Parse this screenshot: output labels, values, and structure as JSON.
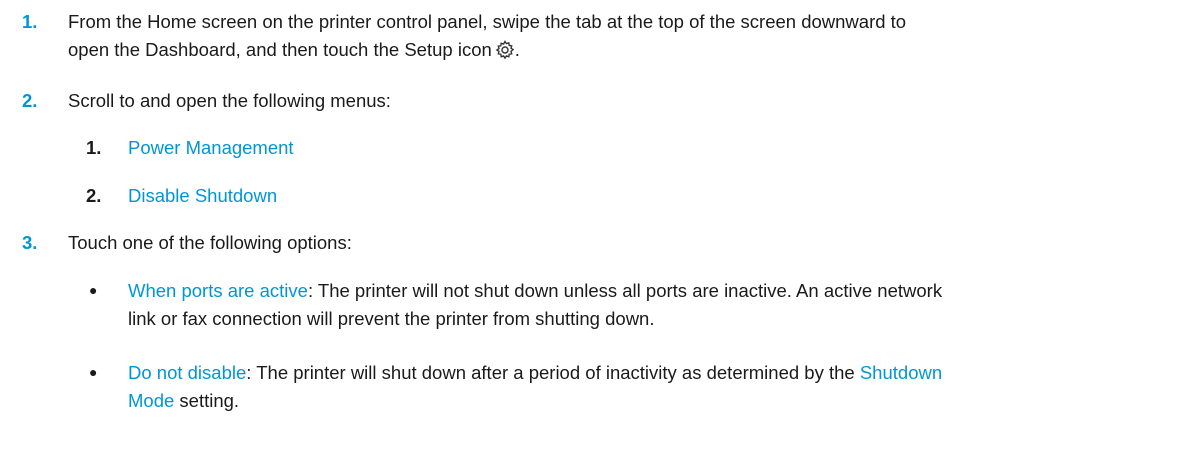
{
  "steps": [
    {
      "number": "1.",
      "text_a": "From the Home screen on the printer control panel, swipe the tab at the top of the screen downward to",
      "text_b": "open the Dashboard, and then touch the Setup icon",
      "text_b_end": "."
    },
    {
      "number": "2.",
      "text": "Scroll to and open the following menus:",
      "submenus": [
        {
          "number": "1.",
          "label": "Power Management"
        },
        {
          "number": "2.",
          "label": "Disable Shutdown"
        }
      ]
    },
    {
      "number": "3.",
      "text": "Touch one of the following options:",
      "options": [
        {
          "term": "When ports are active",
          "line1": ": The printer will not shut down unless all ports are inactive. An active network",
          "line2": "link or fax connection will prevent the printer from shutting down."
        },
        {
          "term": "Do not disable",
          "line1": ": The printer will shut down after a period of inactivity as determined by the",
          "term2_a": "Shutdown",
          "term2_b": "Mode",
          "line2": " setting."
        }
      ]
    }
  ],
  "icons": {
    "setup": "gear-icon",
    "bullet": "bullet-icon"
  },
  "colors": {
    "accent": "#0096d6",
    "text": "#1a1a1a"
  }
}
